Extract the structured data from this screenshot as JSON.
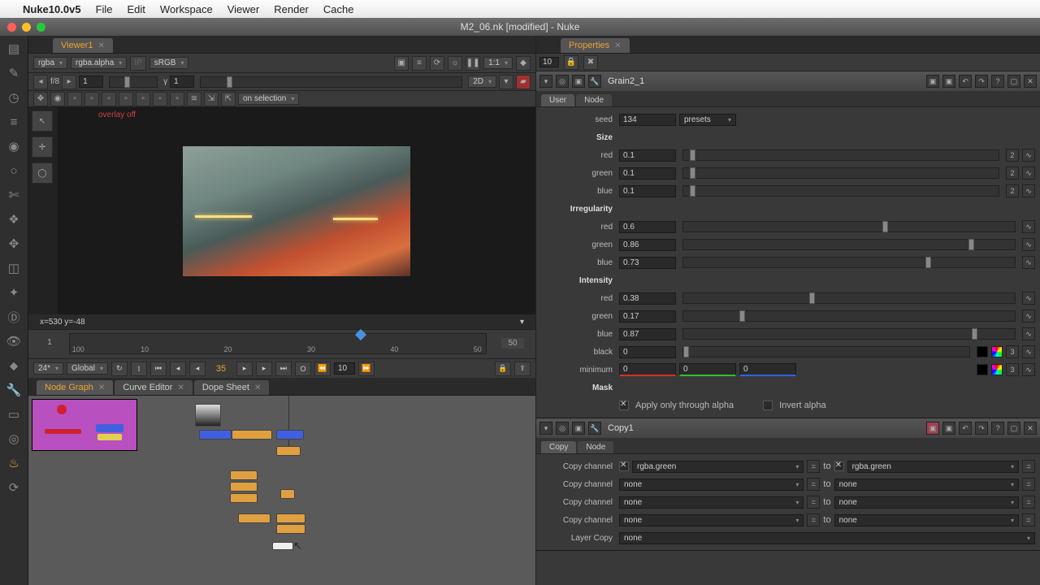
{
  "app": {
    "name": "Nuke10.0v5",
    "title": "M2_06.nk [modified] - Nuke"
  },
  "menubar": [
    "File",
    "Edit",
    "Workspace",
    "Viewer",
    "Render",
    "Cache"
  ],
  "viewer": {
    "tab": "Viewer1",
    "channel": "rgba",
    "alpha": "rgba.alpha",
    "ip": "IP",
    "cs": "sRGB",
    "zoom": "1:1",
    "f": "f/8",
    "x": "1",
    "y": "1",
    "dim": "2D",
    "onsel": "on selection",
    "overlay": "overlay off",
    "coord": "x=530 y=-48",
    "tl_start": "1",
    "tl_end": "50",
    "playhead": "35",
    "ticks": [
      "100",
      "10",
      "20",
      "30",
      "40",
      "50"
    ],
    "tick_pos": [
      2,
      18,
      38,
      58,
      78,
      98
    ],
    "fps": "24*",
    "scope": "Global",
    "cur": "35",
    "skip": "10"
  },
  "nodetabs": {
    "t1": "Node Graph",
    "t2": "Curve Editor",
    "t3": "Dope Sheet"
  },
  "props": {
    "title": "Properties",
    "count": "10",
    "grain": {
      "name": "Grain2_1",
      "tab_user": "User",
      "tab_node": "Node",
      "seed_l": "seed",
      "seed": "134",
      "presets": "presets",
      "size_h": "Size",
      "size": {
        "red_l": "red",
        "red": "0.1",
        "green_l": "green",
        "green": "0.1",
        "blue_l": "blue",
        "blue": "0.1",
        "end": "2"
      },
      "irr_h": "Irregularity",
      "irr": {
        "red_l": "red",
        "red": "0.6",
        "green_l": "green",
        "green": "0.86",
        "blue_l": "blue",
        "blue": "0.73"
      },
      "int_h": "Intensity",
      "int": {
        "red_l": "red",
        "red": "0.38",
        "green_l": "green",
        "green": "0.17",
        "blue_l": "blue",
        "blue": "0.87",
        "black_l": "black",
        "black": "0",
        "min_l": "minimum",
        "min_r": "0",
        "min_g": "0",
        "min_b": "0",
        "end": "3"
      },
      "mask_h": "Mask",
      "mask1": "Apply only through alpha",
      "mask2": "Invert alpha"
    },
    "copy": {
      "name": "Copy1",
      "tab_copy": "Copy",
      "tab_node": "Node",
      "ch_l": "Copy channel",
      "to": "to",
      "r1a": "rgba.green",
      "r1b": "rgba.green",
      "r2a": "none",
      "r2b": "none",
      "r3a": "none",
      "r3b": "none",
      "r4a": "none",
      "r4b": "none",
      "layer_l": "Layer Copy",
      "layer": "none"
    }
  }
}
